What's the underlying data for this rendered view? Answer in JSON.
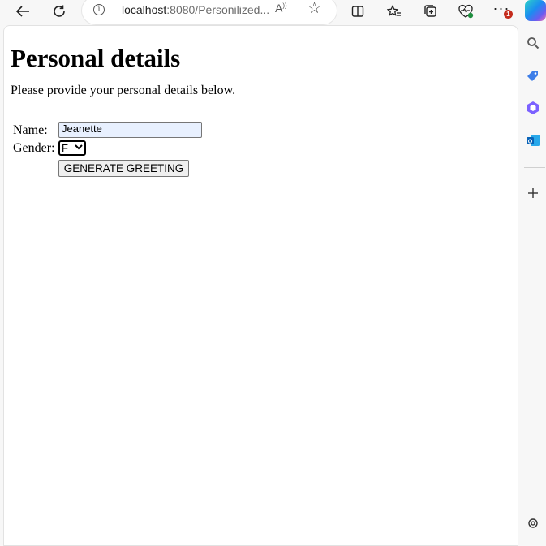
{
  "browser": {
    "url_host": "localhost",
    "url_path": ":8080/Personilized...",
    "read_aloud_icon": "read-aloud-icon",
    "favorites_icon": "star-icon",
    "notification_count": "1"
  },
  "page": {
    "heading": "Personal details",
    "intro": "Please provide your personal details below.",
    "form": {
      "name_label": "Name:",
      "name_value": "Jeanette",
      "gender_label": "Gender:",
      "gender_value": "F",
      "submit_label": "GENERATE GREETING"
    }
  },
  "colors": {
    "autofill_background": "#e8f0fe",
    "notification_badge": "#c42b1c"
  }
}
